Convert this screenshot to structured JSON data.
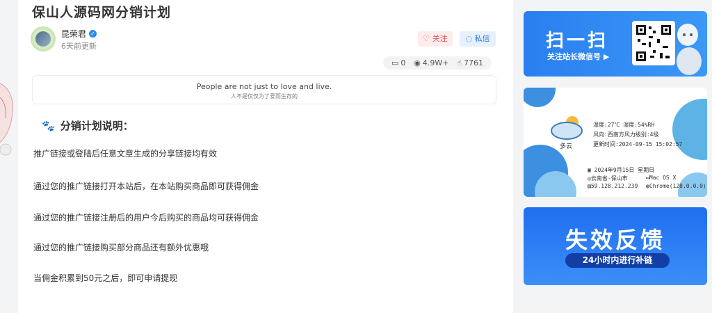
{
  "article": {
    "title": "保山人源码网分销计划",
    "author": "昆荣君",
    "updated": "6天前更新",
    "follow_label": "关注",
    "message_label": "私信",
    "stats": {
      "comments": "0",
      "views": "4.9W+",
      "likes": "7761"
    },
    "quote_en": "People are not just to love and live.",
    "quote_zh": "人不是仅仅为了爱而生存的",
    "section_title": "分销计划说明：",
    "paragraphs": [
      "推广链接或登陆后任意文章生成的分享链接均有效",
      "通过您的推广链接打开本站后，在本站购买商品即可获得佣金",
      "通过您的推广链接注册后的用户今后购买的商品均可获得佣金",
      "通过您的推广链接购买部分商品还有额外优惠哦",
      "当佣金积累到50元之后，即可申请提现"
    ]
  },
  "sidebar": {
    "scan": {
      "title": "扫一扫",
      "subtitle": "关注站长微信号 ▶"
    },
    "weather": {
      "temp": "温度:27℃ 湿度:54%RH",
      "wind": "风向:西南方风力级别:4级",
      "update": "更新时间:2024-09-15 15:02:57",
      "condition": "多云",
      "date": "2024年9月15日 星期日",
      "location": "云南省-保山市",
      "os": "Mac OS X",
      "ip": "59.128.212.239",
      "browser": "Chrome(128.0.0.0)"
    },
    "feedback": {
      "title": "失效反馈",
      "subtitle": "24小时内进行补链"
    }
  },
  "colors": {
    "accent": "#2b7de9",
    "follow": "#e25555",
    "scan_bg": "#2a7ff0",
    "feedback_bg": "#1f6ef0"
  }
}
